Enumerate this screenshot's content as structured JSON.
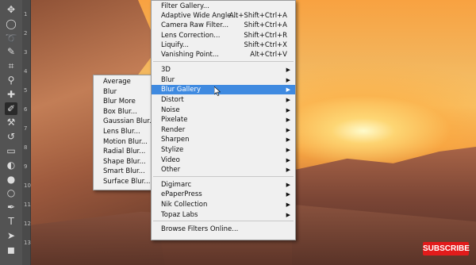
{
  "filter_menu": {
    "top_items": [
      {
        "label": "Filter Gallery...",
        "shortcut": ""
      },
      {
        "label": "Adaptive Wide Angle...",
        "shortcut": "Alt+Shift+Ctrl+A"
      },
      {
        "label": "Camera Raw Filter...",
        "shortcut": "Shift+Ctrl+A"
      },
      {
        "label": "Lens Correction...",
        "shortcut": "Shift+Ctrl+R"
      },
      {
        "label": "Liquify...",
        "shortcut": "Shift+Ctrl+X"
      },
      {
        "label": "Vanishing Point...",
        "shortcut": "Alt+Ctrl+V"
      }
    ],
    "group_items": [
      "3D",
      "Blur",
      "Blur Gallery",
      "Distort",
      "Noise",
      "Pixelate",
      "Render",
      "Sharpen",
      "Stylize",
      "Video",
      "Other"
    ],
    "plugin_items": [
      "Digimarc",
      "ePaperPress",
      "Nik Collection",
      "Topaz Labs"
    ],
    "browse_label": "Browse Filters Online...",
    "highlighted": "Blur Gallery"
  },
  "blur_submenu": {
    "items": [
      "Average",
      "Blur",
      "Blur More",
      "Box Blur...",
      "Gaussian Blur...",
      "Lens Blur...",
      "Motion Blur...",
      "Radial Blur...",
      "Shape Blur...",
      "Smart Blur...",
      "Surface Blur..."
    ]
  },
  "toolbar": {
    "tools": [
      "move-icon",
      "marquee-icon",
      "lasso-icon",
      "quick-select-icon",
      "crop-icon",
      "eyedropper-icon",
      "healing-icon",
      "brush-icon",
      "clone-stamp-icon",
      "history-brush-icon",
      "eraser-icon",
      "paint-bucket-icon",
      "blur-tool-icon",
      "dodge-icon",
      "pen-icon",
      "type-icon",
      "path-select-icon",
      "shape-icon"
    ],
    "active_tool": "brush-icon",
    "side_numbers": [
      "1",
      "2",
      "3",
      "4",
      "5",
      "6",
      "7",
      "8",
      "9",
      "10",
      "11",
      "12",
      "13"
    ]
  },
  "overlay": {
    "subscribe_label": "SUBSCRIBE"
  }
}
